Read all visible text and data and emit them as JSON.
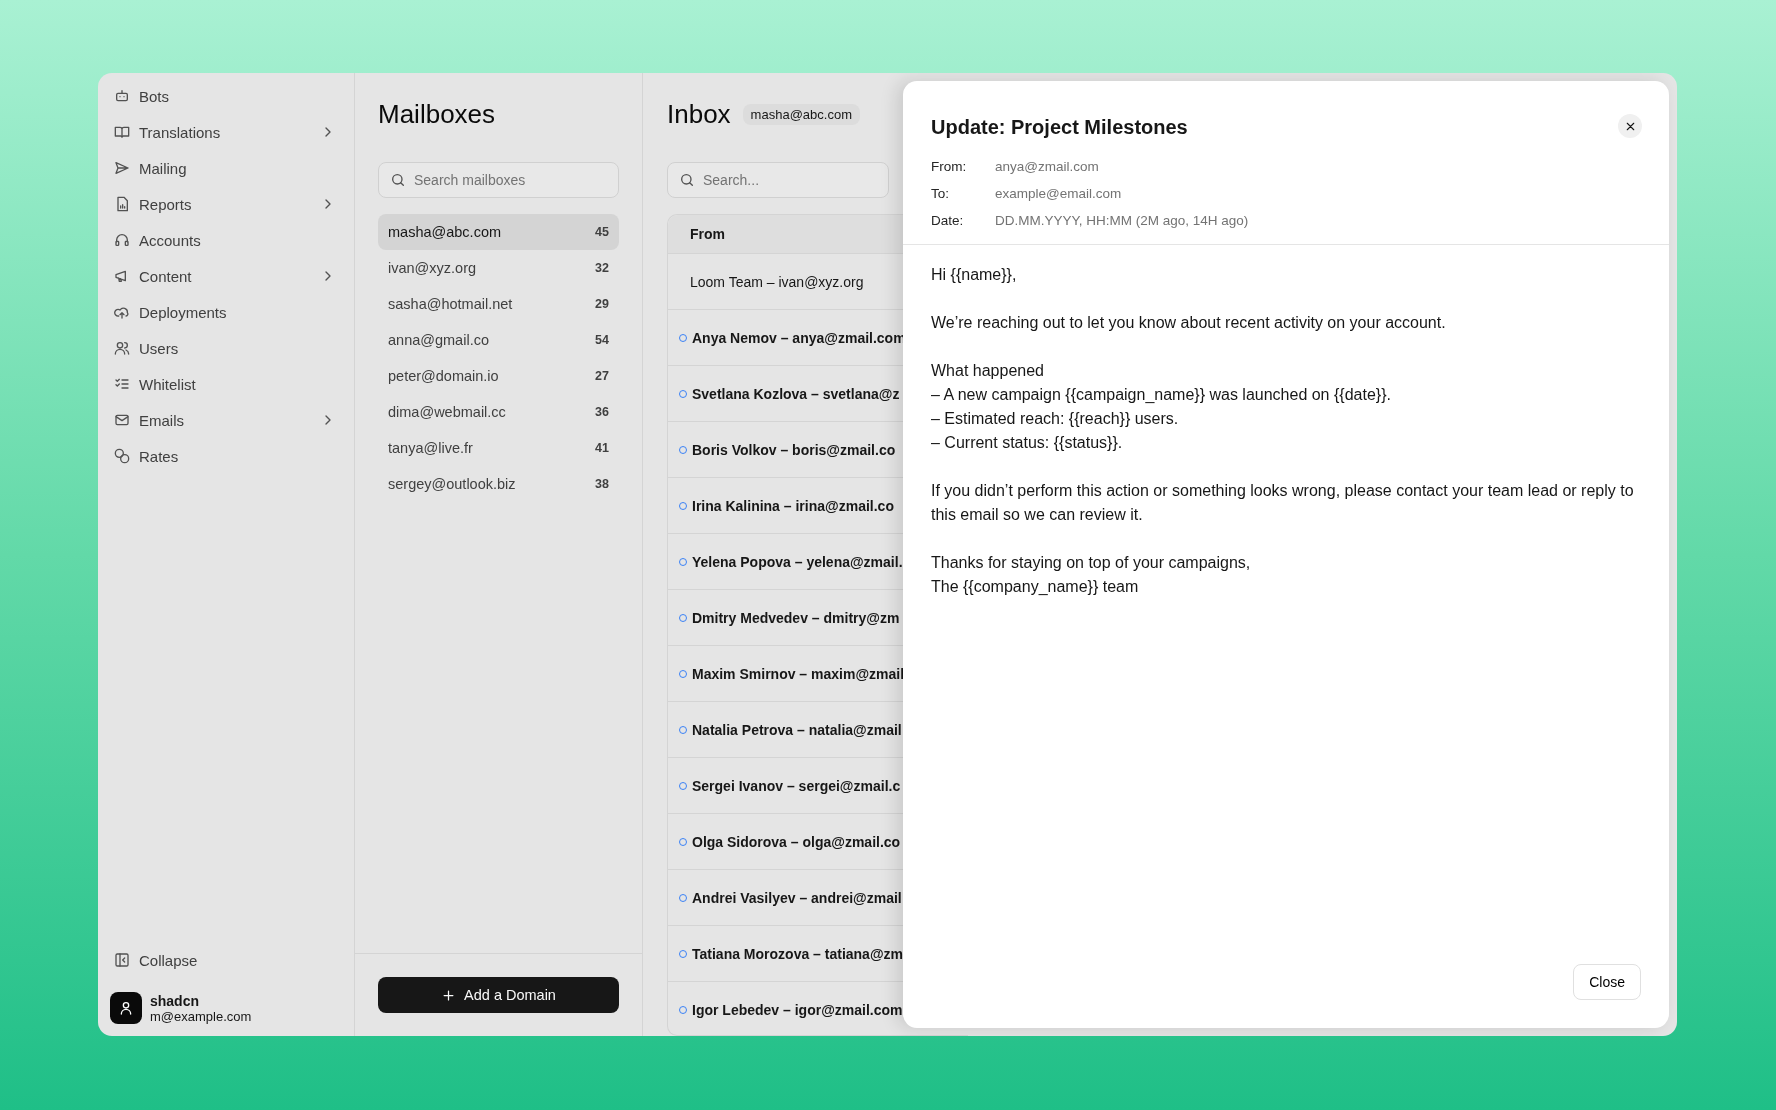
{
  "sidebar": {
    "items": [
      {
        "label": "Bots",
        "has_submenu": false
      },
      {
        "label": "Translations",
        "has_submenu": true
      },
      {
        "label": "Mailing",
        "has_submenu": false
      },
      {
        "label": "Reports",
        "has_submenu": true
      },
      {
        "label": "Accounts",
        "has_submenu": false
      },
      {
        "label": "Content",
        "has_submenu": true
      },
      {
        "label": "Deployments",
        "has_submenu": false
      },
      {
        "label": "Users",
        "has_submenu": false
      },
      {
        "label": "Whitelist",
        "has_submenu": false
      },
      {
        "label": "Emails",
        "has_submenu": true
      },
      {
        "label": "Rates",
        "has_submenu": false
      }
    ],
    "collapse": "Collapse",
    "user": {
      "name": "shadcn",
      "email": "m@example.com"
    }
  },
  "mailboxes": {
    "title": "Mailboxes",
    "search": {
      "placeholder": "Search mailboxes"
    },
    "items": [
      {
        "address": "masha@abc.com",
        "count": "45",
        "selected": true
      },
      {
        "address": "ivan@xyz.org",
        "count": "32",
        "selected": false
      },
      {
        "address": "sasha@hotmail.net",
        "count": "29",
        "selected": false
      },
      {
        "address": "anna@gmail.co",
        "count": "54",
        "selected": false
      },
      {
        "address": "peter@domain.io",
        "count": "27",
        "selected": false
      },
      {
        "address": "dima@webmail.cc",
        "count": "36",
        "selected": false
      },
      {
        "address": "tanya@live.fr",
        "count": "41",
        "selected": false
      },
      {
        "address": "sergey@outlook.biz",
        "count": "38",
        "selected": false
      }
    ],
    "add_button": "Add a Domain"
  },
  "inbox": {
    "title": "Inbox",
    "badge": "masha@abc.com",
    "search": {
      "placeholder": "Search..."
    },
    "columns": [
      "From"
    ],
    "rows": [
      {
        "from": "Loom Team – ivan@xyz.org",
        "unread": false
      },
      {
        "from": "Anya Nemov – anya@zmail.com",
        "unread": true
      },
      {
        "from": "Svetlana Kozlova – svetlana@z",
        "unread": true
      },
      {
        "from": "Boris Volkov – boris@zmail.co",
        "unread": true
      },
      {
        "from": "Irina Kalinina – irina@zmail.co",
        "unread": true
      },
      {
        "from": "Yelena Popova – yelena@zmail.",
        "unread": true
      },
      {
        "from": "Dmitry Medvedev – dmitry@zm",
        "unread": true
      },
      {
        "from": "Maxim Smirnov – maxim@zmail",
        "unread": true
      },
      {
        "from": "Natalia Petrova – natalia@zmail",
        "unread": true
      },
      {
        "from": "Sergei Ivanov – sergei@zmail.c",
        "unread": true
      },
      {
        "from": "Olga Sidorova – olga@zmail.co",
        "unread": true
      },
      {
        "from": "Andrei Vasilyev – andrei@zmail",
        "unread": true
      },
      {
        "from": "Tatiana Morozova – tatiana@zm",
        "unread": true
      },
      {
        "from": "Igor Lebedev – igor@zmail.com",
        "unread": true
      }
    ]
  },
  "dialog": {
    "title": "Update: Project Milestones",
    "meta": [
      {
        "label": "From:",
        "value": "anya@zmail.com"
      },
      {
        "label": "To:",
        "value": "example@email.com"
      },
      {
        "label": "Date:",
        "value": "DD.MM.YYYY, HH:MM (2M ago, 14H ago)"
      }
    ],
    "body": [
      [
        "Hi {{name}},"
      ],
      [
        "We’re reaching out to let you know about recent activity on your account."
      ],
      [
        "What happened",
        "– A new campaign {{campaign_name}} was launched on {{date}}.",
        "– Estimated reach: {{reach}} users.",
        "– Current status: {{status}}."
      ],
      [
        "If you didn’t perform this action or something looks wrong, please contact your team lead or reply to this email so we can review it."
      ],
      [
        "Thanks for staying on top of your campaigns,",
        "The {{company_name}} team"
      ]
    ],
    "close_button": "Close"
  }
}
